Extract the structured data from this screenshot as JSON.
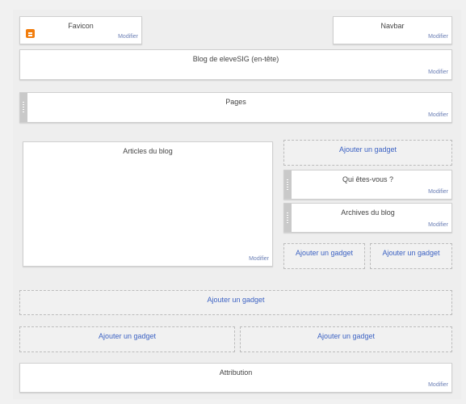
{
  "layout": {
    "favicon": {
      "title": "Favicon",
      "edit": "Modifier",
      "icon": "blogger-icon"
    },
    "navbar": {
      "title": "Navbar",
      "edit": "Modifier"
    },
    "header": {
      "title": "Blog de eleveSIG (en-tête)",
      "edit": "Modifier"
    },
    "pages": {
      "title": "Pages",
      "edit": "Modifier"
    },
    "main": {
      "title": "Articles du blog",
      "edit": "Modifier"
    },
    "sidebar": {
      "add_top": "Ajouter un gadget",
      "profile": {
        "title": "Qui êtes-vous ?",
        "edit": "Modifier"
      },
      "archive": {
        "title": "Archives du blog",
        "edit": "Modifier"
      },
      "add_left": "Ajouter un gadget",
      "add_right": "Ajouter un gadget"
    },
    "footer": {
      "add_full": "Ajouter un gadget",
      "add_left": "Ajouter un gadget",
      "add_right": "Ajouter un gadget"
    },
    "attribution": {
      "title": "Attribution",
      "edit": "Modifier"
    }
  },
  "colors": {
    "link": "#3c62c3",
    "edit_link": "#6b7fb5",
    "blogger_orange": "#f27d0c"
  }
}
